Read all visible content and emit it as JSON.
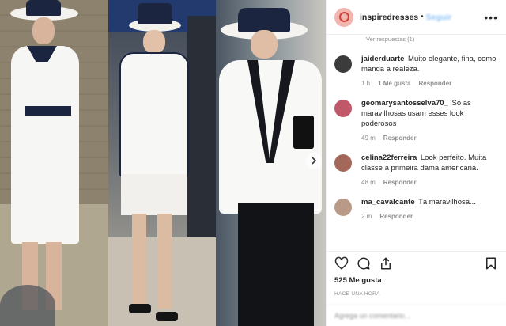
{
  "header": {
    "username": "inspiredresses",
    "separator": "•",
    "follow_label": "Seguir",
    "more_label": "•••"
  },
  "comments": {
    "replies_label": "Ver respuestas (1)",
    "items": [
      {
        "user": "jaiderduarte",
        "text": "Muito elegante, fina, como manda a realeza.",
        "time": "1 h",
        "likes": "1 Me gusta",
        "reply": "Responder",
        "avatar_color": "#3b3b3b"
      },
      {
        "user": "geomarysantosselva70_",
        "text": "Só as maravilhosas usam esses look poderosos",
        "time": "49 m",
        "likes": "",
        "reply": "Responder",
        "avatar_color": "#c0586a"
      },
      {
        "user": "celina22ferreira",
        "text": "Look perfeito. Muita classe a primeira dama americana.",
        "time": "48 m",
        "likes": "",
        "reply": "Responder",
        "avatar_color": "#a4685a"
      },
      {
        "user": "ma_cavalcante",
        "text": "Tá maravilhosa...",
        "time": "2 m",
        "likes": "",
        "reply": "Responder",
        "avatar_color": "#b89a86"
      }
    ]
  },
  "post": {
    "likes_count": "525 Me gusta",
    "posted_ago": "HACE UNA HORA",
    "add_comment_placeholder": "Agrega un comentario..."
  },
  "icons": {
    "like": "heart-icon",
    "comment": "comment-icon",
    "share": "share-icon",
    "save": "bookmark-icon",
    "next": "chevron-right-icon"
  }
}
